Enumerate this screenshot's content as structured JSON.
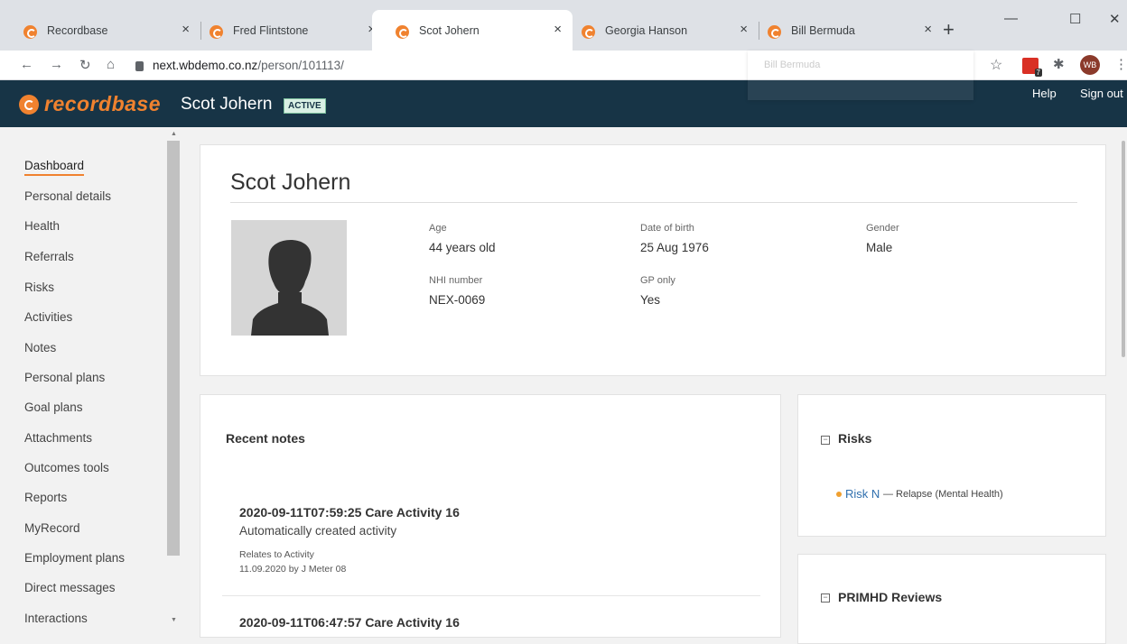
{
  "browser": {
    "tabs": [
      {
        "label": "Recordbase",
        "close": "×"
      },
      {
        "label": "Fred Flintstone",
        "close": "×"
      },
      {
        "label": "Scot Johern",
        "close": "×"
      },
      {
        "label": "Georgia Hanson",
        "close": "×"
      },
      {
        "label": "Bill Bermuda",
        "close": "×"
      }
    ],
    "new_tab": "+",
    "window_controls": {
      "minimize": "—",
      "maximize": "☐",
      "close": "✕"
    },
    "url_host": "next.wbdemo.co.nz",
    "url_path": "/person/101113/",
    "tooltip_title": "Bill Bermuda",
    "extension_badge": "7",
    "profile_initials": "WB"
  },
  "app": {
    "brand": "recordbase",
    "person_name": "Scot Johern",
    "status_badge": "ACTIVE",
    "help_link": "Help",
    "signout_link": "Sign out"
  },
  "sidebar": {
    "items": [
      {
        "label": "Dashboard"
      },
      {
        "label": "Personal details"
      },
      {
        "label": "Health"
      },
      {
        "label": "Referrals"
      },
      {
        "label": "Risks"
      },
      {
        "label": "Activities"
      },
      {
        "label": "Notes"
      },
      {
        "label": "Personal plans"
      },
      {
        "label": "Goal plans"
      },
      {
        "label": "Attachments"
      },
      {
        "label": "Outcomes tools"
      },
      {
        "label": "Reports"
      },
      {
        "label": "MyRecord"
      },
      {
        "label": "Employment plans"
      },
      {
        "label": "Direct messages"
      },
      {
        "label": "Interactions"
      }
    ]
  },
  "profile": {
    "title": "Scot Johern",
    "fields": {
      "age_label": "Age",
      "age_value": "44 years old",
      "dob_label": "Date of birth",
      "dob_value": "25 Aug 1976",
      "gender_label": "Gender",
      "gender_value": "Male",
      "nhi_label": "NHI number",
      "nhi_value": "NEX-0069",
      "gp_label": "GP only",
      "gp_value": "Yes"
    }
  },
  "recent_notes": {
    "title": "Recent notes",
    "items": [
      {
        "title": "2020-09-11T07:59:25 Care Activity 16",
        "subtitle": "Automatically created activity",
        "relates": "Relates to Activity",
        "meta": "11.09.2020 by J Meter 08"
      },
      {
        "title": "2020-09-11T06:47:57 Care Activity 16"
      }
    ]
  },
  "risks": {
    "title": "Risks",
    "toggle": "−",
    "items": [
      {
        "link": "Risk N",
        "desc": "— Relapse (Mental Health)"
      }
    ]
  },
  "primhd": {
    "title": "PRIMHD Reviews",
    "toggle": "−"
  },
  "colors": {
    "brand_orange": "#f0822f",
    "header_navy": "#173446",
    "link_blue": "#2f6fae"
  }
}
